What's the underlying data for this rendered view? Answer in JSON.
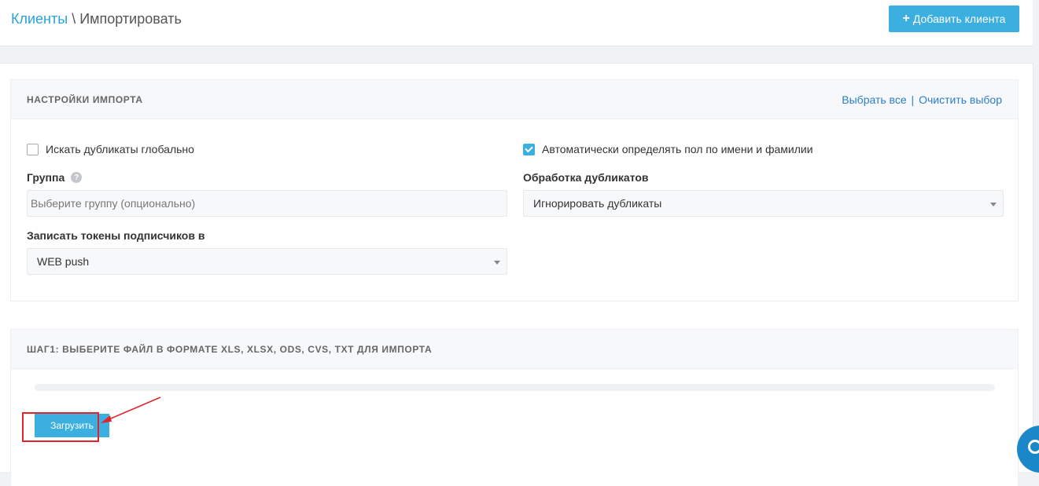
{
  "header": {
    "breadcrumb_root": "Клиенты",
    "breadcrumb_sep": "\\",
    "breadcrumb_current": "Импортировать",
    "add_client_label": "Добавить клиента",
    "add_client_icon": "plus-icon"
  },
  "settings": {
    "title": "НАСТРОЙКИ ИМПОРТА",
    "select_all": "Выбрать все",
    "links_sep": "|",
    "clear_selection": "Очистить выбор",
    "search_duplicates_label": "Искать дубликаты глобально",
    "search_duplicates_checked": false,
    "auto_gender_label": "Автоматически определять пол по имени и фамилии",
    "auto_gender_checked": true,
    "group_label": "Группа",
    "group_help_icon": "question-icon",
    "group_placeholder": "Выберите группу (опционально)",
    "group_value": "",
    "duplicates_label": "Обработка дубликатов",
    "duplicates_value": "Игнорировать дубликаты",
    "tokens_label": "Записать токены подписчиков в",
    "tokens_value": "WEB push"
  },
  "step1": {
    "title": "ШАГ1: ВЫБЕРИТЕ ФАЙЛ В ФОРМАТЕ XLS, XLSX, ODS, CVS, TXT ДЛЯ ИМПОРТА",
    "progress_fraction": 0,
    "upload_label": "Загрузить"
  },
  "colors": {
    "accent": "#3bb0e0",
    "link": "#2a7fc8",
    "annotation": "#e0232d"
  }
}
